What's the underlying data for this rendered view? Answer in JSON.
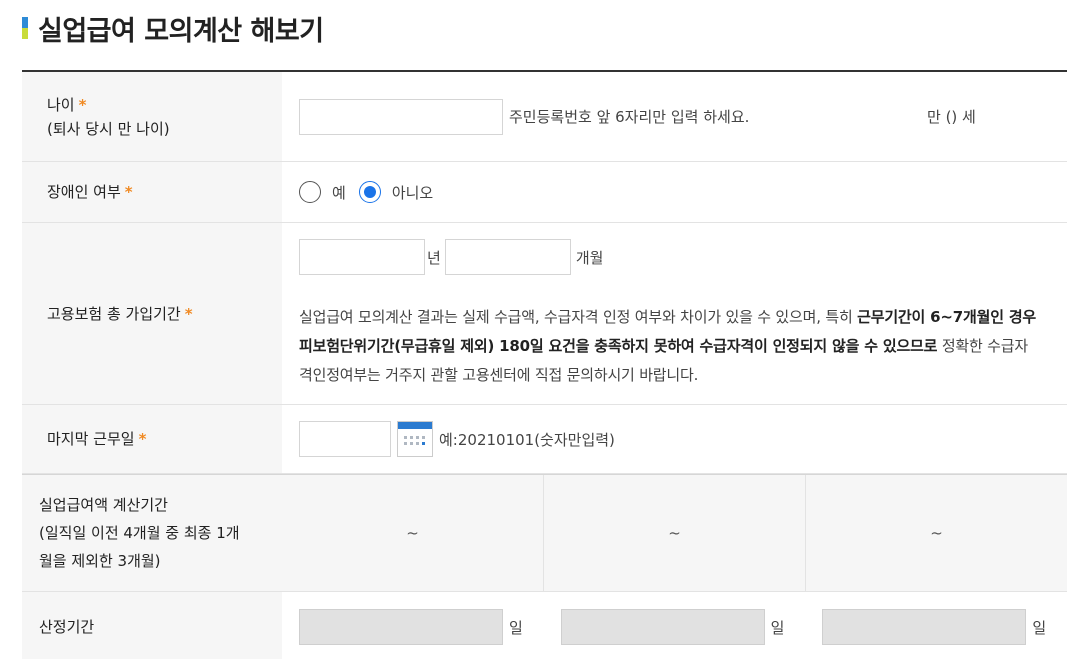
{
  "page_title": "실업급여 모의계산 해보기",
  "age": {
    "label": "나이",
    "sublabel": "(퇴사 당시 만 나이)",
    "required_mark": "*",
    "hint": "주민등록번호 앞 6자리만 입력 하세요.",
    "result": "만 () 세"
  },
  "disability": {
    "label": "장애인 여부",
    "required_mark": "*",
    "option_yes": "예",
    "option_no": "아니오",
    "selected": "아니오"
  },
  "insurance_period": {
    "label": "고용보험 총 가입기간",
    "required_mark": "*",
    "year_unit": "년",
    "month_unit": "개월",
    "notice_part1": "실업급여 모의계산 결과는 실제 수급액, 수급자격 인정 여부와 차이가 있을 수 있으며, 특히 ",
    "notice_bold": "근무기간이 6~7개월인 경우 피보험단위기간(무급휴일 제외) 180일 요건을 충족하지 못하여 수급자격이 인정되지 않을 수 있으므로",
    "notice_part2": " 정확한 수급자격인정여부는 거주지 관할 고용센터에 직접 문의하시기 바랍니다."
  },
  "last_work_day": {
    "label": "마지막 근무일",
    "required_mark": "*",
    "hint": "예:20210101(숫자만입력)"
  },
  "calc_period": {
    "label_line1": "실업급여액 계산기간",
    "label_line2": "(일직일 이전 4개월 중 최종 1개",
    "label_line3": "월을 제외한 3개월)",
    "cells": [
      "~",
      "~",
      "~"
    ]
  },
  "computed_period": {
    "label": "산정기간",
    "unit": "일"
  }
}
